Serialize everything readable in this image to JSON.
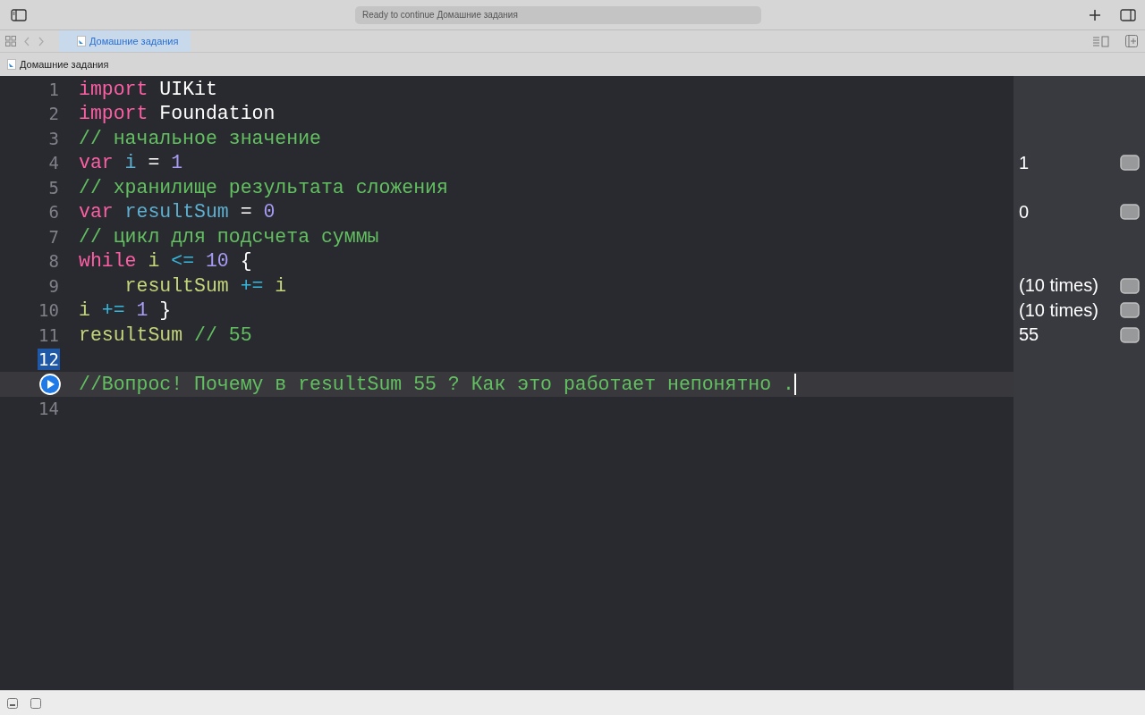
{
  "toolbar": {
    "status": "Ready to continue Домашние задания"
  },
  "tabs": [
    {
      "label": "Домашние задания",
      "selected": true
    }
  ],
  "breadcrumb": {
    "label": "Домашние задания"
  },
  "lines": [
    {
      "number": "1",
      "selected": false,
      "current": false,
      "tokens": [
        {
          "t": "import",
          "kind": "kw"
        },
        {
          "t": " UIKit",
          "kind": "plain"
        }
      ]
    },
    {
      "number": "2",
      "selected": false,
      "current": false,
      "tokens": [
        {
          "t": "import",
          "kind": "kw"
        },
        {
          "t": " Foundation",
          "kind": "plain"
        }
      ]
    },
    {
      "number": "3",
      "selected": false,
      "current": false,
      "tokens": [
        {
          "t": "// начальное значение",
          "kind": "comment"
        }
      ]
    },
    {
      "number": "4",
      "selected": false,
      "current": false,
      "result": "1",
      "tokens": [
        {
          "t": "var",
          "kind": "kw"
        },
        {
          "t": " i",
          "kind": "decl"
        },
        {
          "t": " = ",
          "kind": "plain"
        },
        {
          "t": "1",
          "kind": "num"
        }
      ]
    },
    {
      "number": "5",
      "selected": false,
      "current": false,
      "tokens": [
        {
          "t": "// хранилище результата сложения",
          "kind": "comment"
        }
      ]
    },
    {
      "number": "6",
      "selected": false,
      "current": false,
      "result": "0",
      "tokens": [
        {
          "t": "var",
          "kind": "kw"
        },
        {
          "t": " resultSum",
          "kind": "decl"
        },
        {
          "t": " = ",
          "kind": "plain"
        },
        {
          "t": "0",
          "kind": "num"
        }
      ]
    },
    {
      "number": "7",
      "selected": false,
      "current": false,
      "tokens": [
        {
          "t": "// цикл для подсчета суммы",
          "kind": "comment"
        }
      ]
    },
    {
      "number": "8",
      "selected": false,
      "current": false,
      "tokens": [
        {
          "t": "while",
          "kind": "kw"
        },
        {
          "t": " i",
          "kind": "ref"
        },
        {
          "t": " <=",
          "kind": "op"
        },
        {
          "t": " 10",
          "kind": "num"
        },
        {
          "t": " {",
          "kind": "plain"
        }
      ]
    },
    {
      "number": "9",
      "selected": false,
      "current": false,
      "result": "(10 times)",
      "tokens": [
        {
          "t": "    resultSum",
          "kind": "ref"
        },
        {
          "t": " +=",
          "kind": "op"
        },
        {
          "t": " i",
          "kind": "ref"
        }
      ]
    },
    {
      "number": "10",
      "selected": false,
      "current": false,
      "result": "(10 times)",
      "tokens": [
        {
          "t": "i",
          "kind": "ref"
        },
        {
          "t": " +=",
          "kind": "op"
        },
        {
          "t": " 1",
          "kind": "num"
        },
        {
          "t": " }",
          "kind": "plain"
        }
      ]
    },
    {
      "number": "11",
      "selected": false,
      "current": false,
      "result": "55",
      "tokens": [
        {
          "t": "resultSum",
          "kind": "ref"
        },
        {
          "t": " // 55",
          "kind": "comment"
        }
      ]
    },
    {
      "number": "12",
      "selected": true,
      "current": false
    },
    {
      "selected": false,
      "current": true,
      "tokens": [
        {
          "t": "//Вопрос! Почему в resultSum 55 ? Как это работает непонятно .",
          "kind": "comment"
        }
      ]
    },
    {
      "number": "14",
      "selected": false,
      "current": false
    }
  ]
}
